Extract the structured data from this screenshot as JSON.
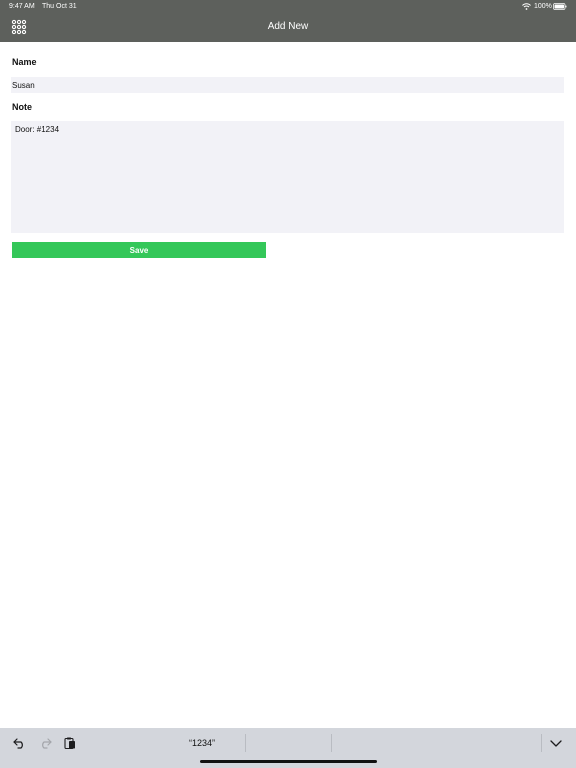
{
  "status_bar": {
    "time": "9:47 AM",
    "date": "Thu Oct 31",
    "battery": "100%"
  },
  "nav": {
    "title": "Add New",
    "menu_icon": "grid-menu-icon"
  },
  "form": {
    "name_label": "Name",
    "name_value": "Susan",
    "note_label": "Note",
    "note_value": "Door: #1234",
    "save_label": "Save"
  },
  "keyboard_bar": {
    "suggestion": "“1234”",
    "icons": [
      "undo-icon",
      "redo-icon",
      "paste-icon",
      "keyboard-dismiss-icon"
    ]
  },
  "colors": {
    "nav_bg": "#5d605c",
    "field_bg": "#f2f2f7",
    "save_bg": "#34c759",
    "keyboard_bar_bg": "#d3d6dc"
  }
}
